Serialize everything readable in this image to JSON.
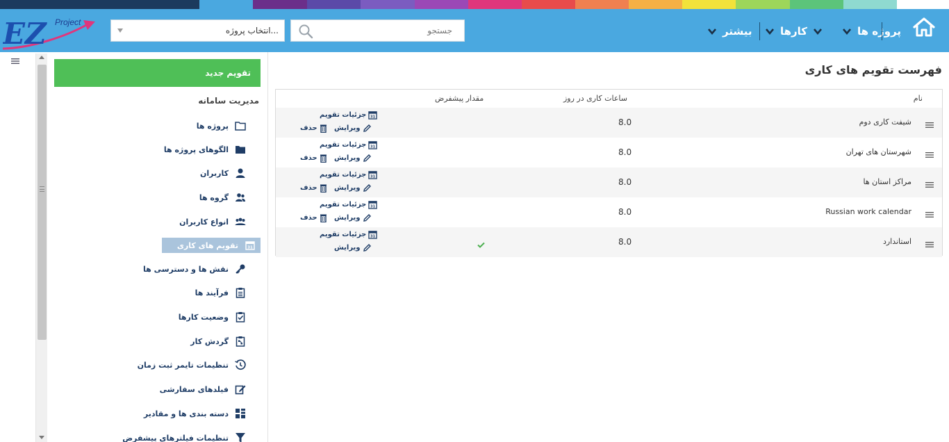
{
  "theme": {
    "header_bg": "#4aa8e0",
    "accent_green": "#4fbf57",
    "active_item_bg": "#aac4dc",
    "link_color": "#1f3d66",
    "color_strip": [
      "#1c3a5e",
      "#4aa8e0",
      "#6b2f8a",
      "#5b4aa8",
      "#7b5cc0",
      "#9b48b6",
      "#e0367c",
      "#e84b4b",
      "#f08050",
      "#f5b045",
      "#f2e23a",
      "#9dd65a",
      "#5cc47a",
      "#8fdad0"
    ]
  },
  "logo": {
    "letters": "EZ",
    "superscript": "Project"
  },
  "header": {
    "nav": [
      {
        "label": "پروژه ها",
        "icon": "chevron-down-icon"
      },
      {
        "label": "کارها",
        "icon": "chevron-down-icon"
      },
      {
        "label": "بیشتر",
        "icon": "chevron-down-icon"
      }
    ],
    "search_placeholder": "جستجو",
    "project_select": "انتخاب پروژه..."
  },
  "sidebar": {
    "new_calendar_label": "تقویم جدید",
    "section_title": "مدیریت سامانه",
    "items": [
      {
        "label": "پروژه ها",
        "icon": "folder-outline-icon"
      },
      {
        "label": "الگوهای پروژه ها",
        "icon": "folder-icon"
      },
      {
        "label": "کاربران",
        "icon": "user-icon"
      },
      {
        "label": "گروه ها",
        "icon": "users-icon"
      },
      {
        "label": "انواع کاربران",
        "icon": "user-group-icon"
      },
      {
        "label": "تقویم های کاری",
        "icon": "calendar-icon",
        "active": true
      },
      {
        "label": "نقش ها و دسترسی ها",
        "icon": "key-icon"
      },
      {
        "label": "فرآیند ها",
        "icon": "clipboard-icon"
      },
      {
        "label": "وضعیت کارها",
        "icon": "clipboard-check-icon"
      },
      {
        "label": "گردش کار",
        "icon": "workflow-icon"
      },
      {
        "label": "تنظیمات تایمر ثبت زمان",
        "icon": "history-icon"
      },
      {
        "label": "فیلدهای سفارشی",
        "icon": "edit-icon"
      },
      {
        "label": "دسته بندی ها و مقادیر",
        "icon": "grid-list-icon"
      },
      {
        "label": "تنظیمات فیلترهای پیشفرض",
        "icon": "filter-icon"
      }
    ]
  },
  "main": {
    "title": "فهرست تقویم های کاری",
    "columns": {
      "name": "نام",
      "hours": "ساعات کاری در روز",
      "default": "مقدار پیشفرض"
    },
    "action_labels": {
      "details": "جزئیات تقویم",
      "edit": "ویرایش",
      "delete": "حذف"
    },
    "rows": [
      {
        "name": "شیفت کاری دوم",
        "hours": "8.0",
        "is_default": false,
        "deletable": true
      },
      {
        "name": "شهرستان های تهران",
        "hours": "8.0",
        "is_default": false,
        "deletable": true
      },
      {
        "name": "مراکز استان ها",
        "hours": "8.0",
        "is_default": false,
        "deletable": true
      },
      {
        "name": "Russian work calendar",
        "hours": "8.0",
        "is_default": false,
        "deletable": true
      },
      {
        "name": "استاندارد",
        "hours": "8.0",
        "is_default": true,
        "deletable": false
      }
    ]
  }
}
